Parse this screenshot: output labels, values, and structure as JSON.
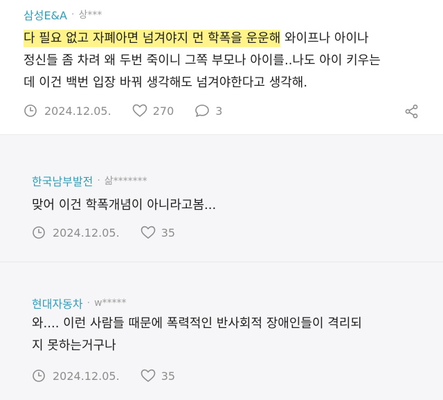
{
  "comments": [
    {
      "company": "삼성E&A",
      "separator": "·",
      "user": "상***",
      "highlight": "다 필요 없고 자폐아면 넘겨야지 먼 학폭을 운운해",
      "line1_rest": " 와이프나 아이나",
      "line2": "정신들 좀 차려 왜 두번 죽이니 그쪽 부모나 아이를..나도 아이 키우는",
      "line3": "데 이건 백번 입장 바꿔 생각해도 넘겨야한다고 생각해.",
      "date": "2024.12.05.",
      "likes": "270",
      "replies": "3"
    },
    {
      "company": "한국남부발전",
      "separator": "·",
      "user": "삶*******",
      "line1": "맞어 이건 학폭개념이 아니라고봄...",
      "date": "2024.12.05.",
      "likes": "35"
    },
    {
      "company": "현대자동차",
      "separator": "·",
      "user": "w*****",
      "line1": "와.... 이런 사람들 때문에 폭력적인 반사회적 장애인들이 격리되",
      "line2": "지 못하는거구나",
      "date": "2024.12.05.",
      "likes": "35"
    }
  ],
  "icons": {
    "clock": "clock-icon",
    "heart": "heart-icon",
    "comment": "comment-bubble-icon",
    "share": "share-icon"
  },
  "colors": {
    "company": "#2f9eb8",
    "highlight": "#fff38a",
    "reply_bg": "#f6f6f8",
    "meta_gray": "#8c8c8c"
  }
}
